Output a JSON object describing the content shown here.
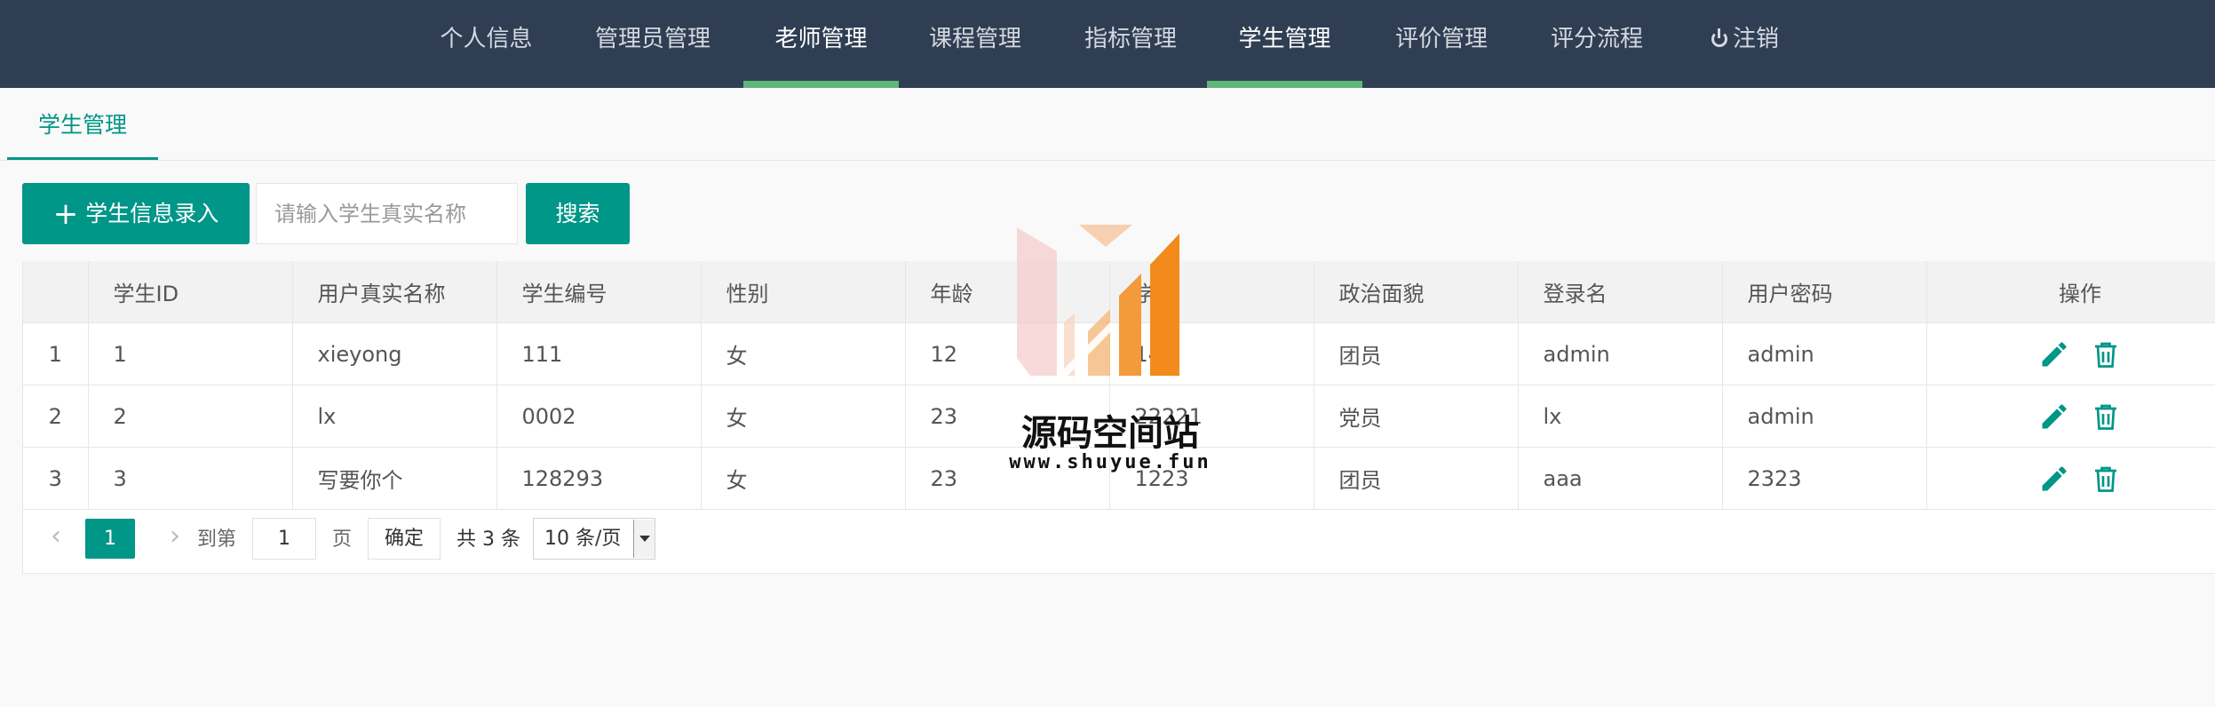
{
  "nav": {
    "items": [
      {
        "label": "个人信息"
      },
      {
        "label": "管理员管理"
      },
      {
        "label": "老师管理"
      },
      {
        "label": "课程管理"
      },
      {
        "label": "指标管理"
      },
      {
        "label": "学生管理"
      },
      {
        "label": "评价管理"
      },
      {
        "label": "评分流程"
      },
      {
        "label": "注销",
        "icon": "power-icon"
      }
    ],
    "active_label": "学生管理",
    "hover_label": "老师管理",
    "colors": {
      "background": "#2f3e53",
      "indicator": "#5fb878"
    }
  },
  "tab": {
    "label": "学生管理",
    "accent": "#009688"
  },
  "toolbar": {
    "add_label": "学生信息录入",
    "add_icon": "plus-icon",
    "search_placeholder": "请输入学生真实名称",
    "search_value": "",
    "search_label": "搜索"
  },
  "table": {
    "headers": [
      "",
      "学生ID",
      "用户真实名称",
      "学生编号",
      "性别",
      "年龄",
      "学号",
      "政治面貌",
      "登录名",
      "用户密码",
      "操作"
    ],
    "rows": [
      {
        "num": "1",
        "id": "1",
        "name": "xieyong",
        "code": "111",
        "gender": "女",
        "age": "12",
        "sid": "14",
        "politics": "团员",
        "login": "admin",
        "password": "admin"
      },
      {
        "num": "2",
        "id": "2",
        "name": "lx",
        "code": "0002",
        "gender": "女",
        "age": "23",
        "sid": "22221",
        "politics": "党员",
        "login": "lx",
        "password": "admin"
      },
      {
        "num": "3",
        "id": "3",
        "name": "写要你个",
        "code": "128293",
        "gender": "女",
        "age": "23",
        "sid": "1223",
        "politics": "团员",
        "login": "aaa",
        "password": "2323"
      }
    ],
    "row_actions": [
      "edit-icon",
      "delete-icon"
    ]
  },
  "pagination": {
    "current_page": "1",
    "goto_prefix": "到第",
    "goto_value": "1",
    "goto_suffix": "页",
    "confirm_label": "确定",
    "total_text": "共 3 条",
    "page_size": "10 条/页"
  },
  "watermark": {
    "title": "源码空间站",
    "url": "www.shuyue.fun"
  }
}
